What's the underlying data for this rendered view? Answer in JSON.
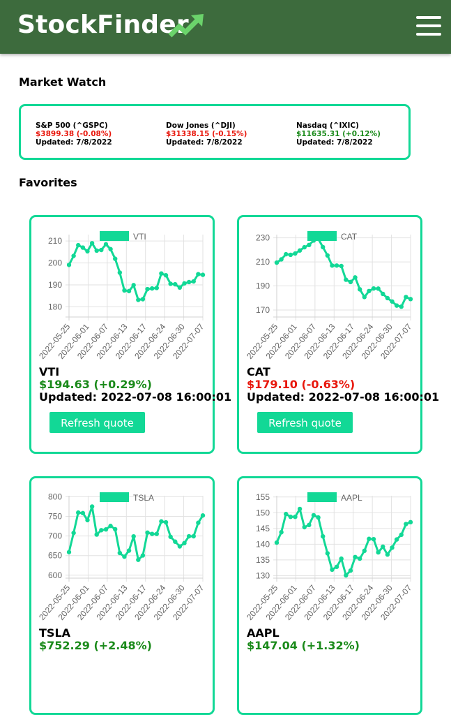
{
  "nav": {
    "brand": "StockFinder",
    "icon": "trend-up-icon",
    "menu_icon": "hamburger-menu-icon"
  },
  "market_watch": {
    "title": "Market Watch",
    "items": [
      {
        "name": "S&P 500 (^GSPC)",
        "quote": "$3899.38 (-0.08%)",
        "updated": "Updated: 7/8/2022",
        "direction": "down"
      },
      {
        "name": "Dow Jones (^DJI)",
        "quote": "$31338.15 (-0.15%)",
        "updated": "Updated: 7/8/2022",
        "direction": "down"
      },
      {
        "name": "Nasdaq (^IXIC)",
        "quote": "$11635.31 (+0.12%)",
        "updated": "Updated: 7/8/2022",
        "direction": "up"
      }
    ]
  },
  "favorites": {
    "title": "Favorites",
    "refresh_label": "Refresh quote",
    "cards": [
      {
        "symbol": "VTI",
        "price": "$194.63 (+0.29%)",
        "direction": "up",
        "updated": "Updated: 2022-07-08 16:00:01"
      },
      {
        "symbol": "CAT",
        "price": "$179.10 (-0.63%)",
        "direction": "down",
        "updated": "Updated: 2022-07-08 16:00:01"
      },
      {
        "symbol": "TSLA",
        "price": "$752.29 (+2.48%)",
        "direction": "up",
        "updated": ""
      },
      {
        "symbol": "AAPL",
        "price": "$147.04 (+1.32%)",
        "direction": "up",
        "updated": ""
      }
    ]
  },
  "colors": {
    "accent": "#12d896",
    "navbar": "#3d6b3d",
    "up": "#1a8a1a",
    "down": "#e8170c"
  },
  "chart_data": [
    {
      "type": "line",
      "legend": "VTI",
      "x_ticks": [
        "2022-05-25",
        "2022-06-01",
        "2022-06-07",
        "2022-06-13",
        "2022-06-17",
        "2022-06-24",
        "2022-06-30",
        "2022-07-07"
      ],
      "y_ticks": [
        180,
        190,
        200,
        210
      ],
      "ylim": [
        175.4,
        212.9
      ],
      "values": [
        199.1,
        203.2,
        208.1,
        207.0,
        205.3,
        209.0,
        205.6,
        205.9,
        208.5,
        206.3,
        201.9,
        195.6,
        187.5,
        187.2,
        189.9,
        183.2,
        183.5,
        188.1,
        188.4,
        188.6,
        195.2,
        194.4,
        190.5,
        190.3,
        188.8,
        190.7,
        191.3,
        191.6,
        194.9,
        194.6
      ],
      "grid": true
    },
    {
      "type": "line",
      "legend": "CAT",
      "x_ticks": [
        "2022-05-25",
        "2022-06-01",
        "2022-06-07",
        "2022-06-13",
        "2022-06-17",
        "2022-06-24",
        "2022-06-30",
        "2022-07-07"
      ],
      "y_ticks": [
        170,
        190,
        210,
        230
      ],
      "ylim": [
        164.2,
        232.7
      ],
      "values": [
        209.4,
        212.1,
        216.4,
        215.9,
        217.0,
        219.5,
        222.2,
        224.1,
        227.8,
        229.2,
        222.3,
        215.4,
        207.0,
        207.0,
        206.6,
        195.2,
        193.3,
        197.1,
        187.2,
        180.8,
        185.8,
        187.9,
        187.8,
        183.4,
        179.9,
        177.1,
        173.7,
        172.8,
        180.8,
        179.1
      ],
      "grid": true
    },
    {
      "type": "line",
      "legend": "TSLA",
      "x_ticks": [
        "2022-05-25",
        "2022-06-01",
        "2022-06-07",
        "2022-06-13",
        "2022-06-17",
        "2022-06-24",
        "2022-06-30",
        "2022-07-07"
      ],
      "y_ticks": [
        600,
        650,
        700,
        750,
        800
      ],
      "ylim": [
        592.5,
        802.5
      ],
      "values": [
        658.8,
        707.7,
        759.6,
        758.3,
        740.4,
        775.0,
        703.6,
        714.8,
        716.7,
        725.6,
        717.2,
        656.6,
        647.2,
        662.7,
        699.0,
        639.3,
        650.3,
        708.5,
        705.2,
        705.2,
        737.1,
        734.8,
        697.9,
        685.5,
        673.4,
        681.8,
        699.2,
        699.2,
        733.6,
        752.3
      ],
      "grid": true
    },
    {
      "type": "line",
      "legend": "AAPL",
      "x_ticks": [
        "2022-05-25",
        "2022-06-01",
        "2022-06-07",
        "2022-06-13",
        "2022-06-17",
        "2022-06-24",
        "2022-06-30",
        "2022-07-07"
      ],
      "y_ticks": [
        130,
        135,
        140,
        145,
        150,
        155
      ],
      "ylim": [
        129.2,
        155.4
      ],
      "values": [
        140.5,
        143.8,
        149.6,
        148.7,
        148.7,
        151.2,
        145.4,
        146.1,
        149.2,
        148.5,
        142.5,
        137.1,
        131.9,
        132.8,
        135.4,
        130.1,
        131.6,
        135.9,
        135.4,
        137.9,
        141.7,
        141.6,
        137.4,
        139.2,
        136.7,
        138.9,
        141.5,
        143.0,
        146.4,
        147.0
      ],
      "grid": true
    }
  ]
}
